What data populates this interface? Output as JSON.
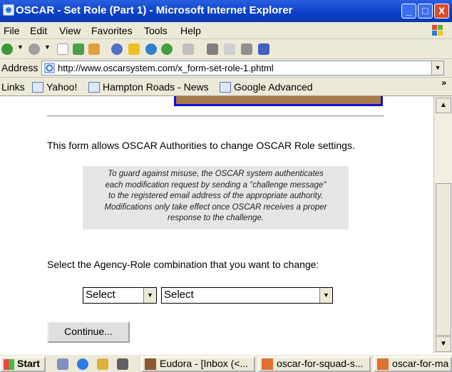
{
  "window": {
    "title": "OSCAR - Set Role (Part 1) - Microsoft Internet Explorer",
    "buttons": {
      "minimize": "_",
      "maximize": "□",
      "close": "X"
    }
  },
  "menu": [
    "File",
    "Edit",
    "View",
    "Favorites",
    "Tools",
    "Help"
  ],
  "address": {
    "label": "Address",
    "url": "http://www.oscarsystem.com/x_form-set-role-1.phtml"
  },
  "links": {
    "label": "Links",
    "items": [
      "Yahoo!",
      "Hampton Roads - News",
      "Google Advanced"
    ],
    "more": "»"
  },
  "content": {
    "intro": "This form allows OSCAR Authorities to change OSCAR Role settings.",
    "notice_lines": [
      "To guard against misuse, the OSCAR system authenticates",
      "each modification request by sending a \"challenge message\"",
      "to the registered email address of the appropriate authority.",
      "Modifications only take effect once OSCAR receives a proper",
      "response to the challenge."
    ],
    "prompt": "Select the Agency-Role combination that you want to change:",
    "agency_select": "Select",
    "role_select": "Select",
    "continue_button": "Continue..."
  },
  "taskbar": {
    "start": "Start",
    "tasks": [
      "Eudora - [Inbox (<...",
      "oscar-for-squad-s...",
      "oscar-for-ma"
    ]
  }
}
